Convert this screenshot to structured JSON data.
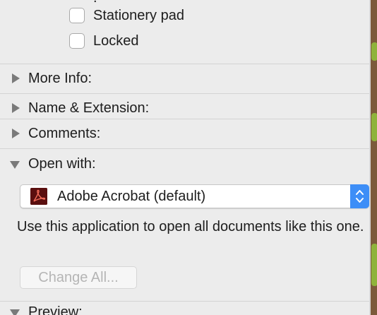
{
  "checkboxes": [
    {
      "label": "Stationery pad",
      "checked": false
    },
    {
      "label": "Locked",
      "checked": false
    }
  ],
  "sections": {
    "more_info": "More Info:",
    "name_extension": "Name & Extension:",
    "comments": "Comments:",
    "open_with": "Open with:",
    "preview": "Preview:"
  },
  "open_with": {
    "selected_app": "Adobe Acrobat (default)",
    "app_icon": "adobe-acrobat-icon",
    "description": "Use this application to open all documents like this one.",
    "change_all_label": "Change All..."
  },
  "colors": {
    "accent": "#3d8ef7",
    "panel_bg": "#ececec",
    "disabled_text": "#b5b5b5"
  }
}
